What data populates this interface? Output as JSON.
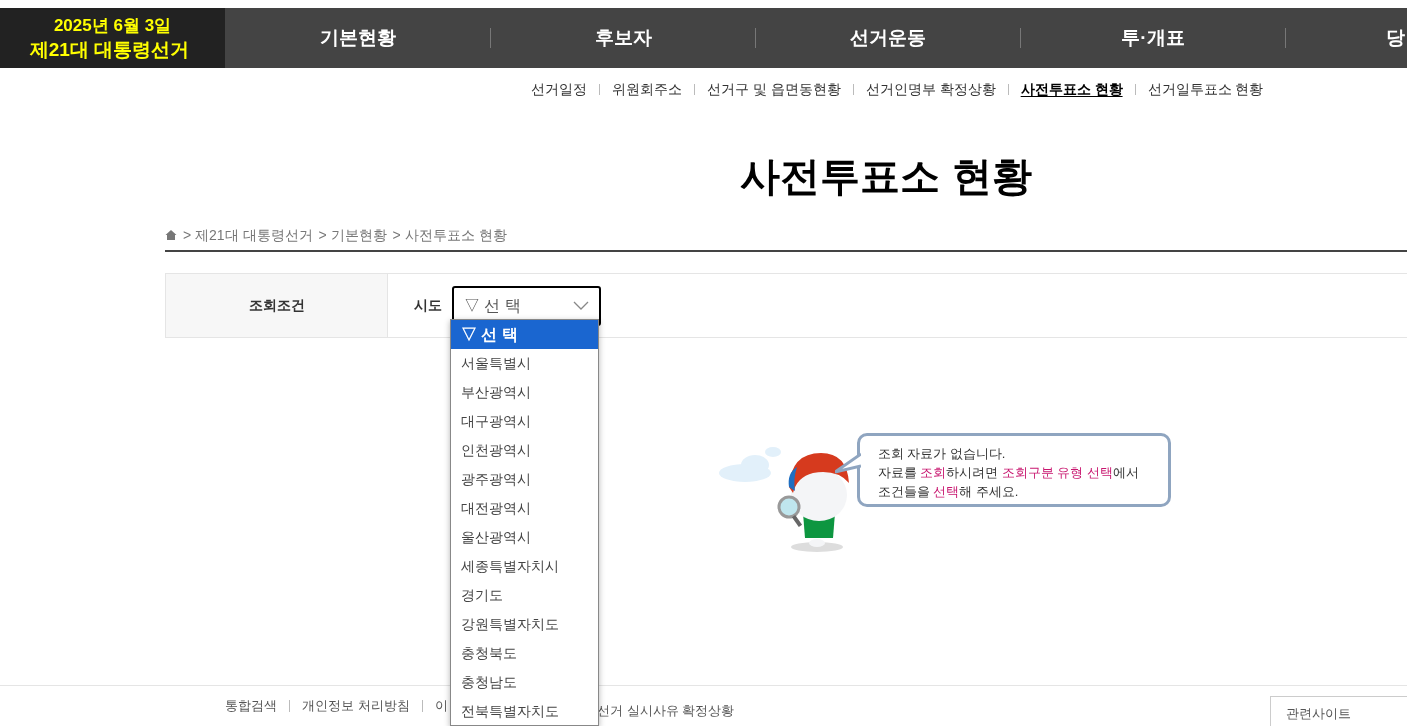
{
  "header": {
    "date": "2025년 6월 3일",
    "election": "제21대 대통령선거"
  },
  "main_nav": [
    "기본현황",
    "후보자",
    "선거운동",
    "투·개표",
    "당"
  ],
  "sub_nav": [
    {
      "label": "선거일정",
      "selected": false
    },
    {
      "label": "위원회주소",
      "selected": false
    },
    {
      "label": "선거구 및 읍면동현황",
      "selected": false
    },
    {
      "label": "선거인명부 확정상황",
      "selected": false
    },
    {
      "label": "사전투표소 현황",
      "selected": true
    },
    {
      "label": "선거일투표소 현황",
      "selected": false
    }
  ],
  "page_title": "사전투표소 현황",
  "breadcrumb": [
    "> 제21대 대통령선거",
    "> 기본현황",
    "> 사전투표소 현황"
  ],
  "query": {
    "label": "조회조건",
    "field_label": "시도",
    "select_value": "▽ 선 택",
    "options": [
      {
        "label": "▽ 선 택",
        "selected": true
      },
      {
        "label": "서울특별시",
        "selected": false
      },
      {
        "label": "부산광역시",
        "selected": false
      },
      {
        "label": "대구광역시",
        "selected": false
      },
      {
        "label": "인천광역시",
        "selected": false
      },
      {
        "label": "광주광역시",
        "selected": false
      },
      {
        "label": "대전광역시",
        "selected": false
      },
      {
        "label": "울산광역시",
        "selected": false
      },
      {
        "label": "세종특별자치시",
        "selected": false
      },
      {
        "label": "경기도",
        "selected": false
      },
      {
        "label": "강원특별자치도",
        "selected": false
      },
      {
        "label": "충청북도",
        "selected": false
      },
      {
        "label": "충청남도",
        "selected": false
      },
      {
        "label": "전북특별자치도",
        "selected": false
      }
    ]
  },
  "empty_message": {
    "lines": [
      [
        {
          "text": "조회 자료가 없습니다.",
          "highlight": false
        }
      ],
      [
        {
          "text": "자료를 ",
          "highlight": false
        },
        {
          "text": "조회",
          "highlight": true
        },
        {
          "text": "하시려면 ",
          "highlight": false
        },
        {
          "text": "조회구분 유형 선택",
          "highlight": true
        },
        {
          "text": "에서",
          "highlight": false
        }
      ],
      [
        {
          "text": "조건들을 ",
          "highlight": false
        },
        {
          "text": "선택",
          "highlight": true
        },
        {
          "text": "해 주세요.",
          "highlight": false
        }
      ]
    ]
  },
  "footer": {
    "links": [
      "통합검색",
      "개인정보 처리방침",
      "이"
    ],
    "cut_link": "선거 실시사유 확정상황",
    "related_sites": "관련사이트"
  }
}
